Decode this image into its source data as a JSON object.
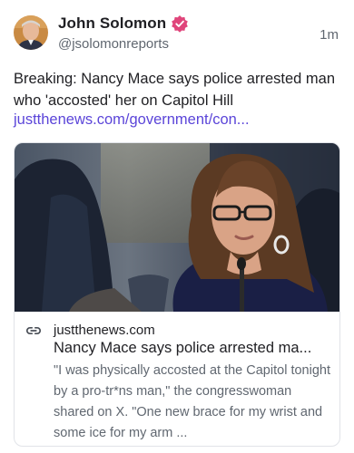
{
  "author": {
    "display_name": "John Solomon",
    "handle": "@jsolomonreports",
    "verified": true,
    "verified_color": "#e0457b"
  },
  "timestamp": "1m",
  "post": {
    "text": "Breaking: Nancy Mace says police arrested man who 'accosted' her on Capitol Hill",
    "link_text": "justthenews.com/government/con...",
    "link_color": "#5b45d9"
  },
  "link_card": {
    "domain": "justthenews.com",
    "title": "Nancy Mace says police arrested ma...",
    "description": "\"I was physically accosted at the Capitol tonight by a pro-tr*ns man,\" the congresswoman shared on X. \"One new brace for my wrist and some ice for my arm ..."
  }
}
